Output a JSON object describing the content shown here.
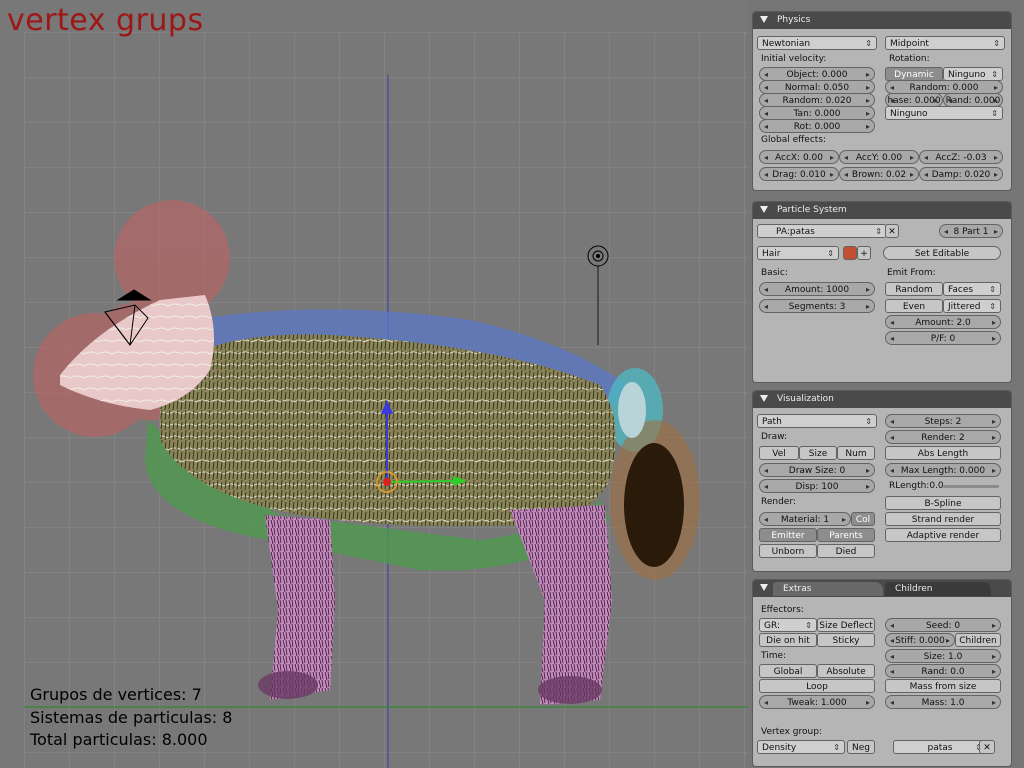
{
  "viewport": {
    "title": "vertex grups",
    "stats": [
      "Grupos de vertices: 7",
      "Sistemas de particulas: 8",
      "Total particulas: 8.000"
    ]
  },
  "physics": {
    "header": "Physics",
    "mode": "Newtonian",
    "integrator": "Midpoint",
    "initial_velocity_label": "Initial velocity:",
    "rotation_label": "Rotation:",
    "object": "Object: 0.000",
    "normal": "Normal: 0.050",
    "random": "Random: 0.020",
    "tan": "Tan: 0.000",
    "rot": "Rot: 0.000",
    "dynamic": "Dynamic",
    "ninguno1": "Ninguno",
    "rot_random": "Random: 0.000",
    "phase": "hase: 0.000",
    "rand": "Rand: 0.000",
    "ninguno2": "Ninguno",
    "global_label": "Global effects:",
    "accx": "AccX: 0.00",
    "accy": "AccY: 0.00",
    "accz": "AccZ: -0.03",
    "drag": "Drag: 0.010",
    "brown": "Brown: 0.02",
    "damp": "Damp: 0.020"
  },
  "particle_system": {
    "header": "Particle System",
    "name": "PA:patas",
    "part": "8 Part 1",
    "type": "Hair",
    "set_editable": "Set Editable",
    "basic_label": "Basic:",
    "emit_label": "Emit From:",
    "amount": "Amount: 1000",
    "segments": "Segments: 3",
    "random": "Random",
    "faces": "Faces",
    "even": "Even",
    "jittered": "Jittered",
    "emit_amount": "Amount: 2.0",
    "pf": "P/F: 0"
  },
  "visualization": {
    "header": "Visualization",
    "path": "Path",
    "draw_label": "Draw:",
    "vel": "Vel",
    "size": "Size",
    "num": "Num",
    "draw_size": "Draw Size: 0",
    "disp": "Disp: 100",
    "render_label": "Render:",
    "material": "Material: 1",
    "col": "Col",
    "emitter": "Emitter",
    "parents": "Parents",
    "unborn": "Unborn",
    "died": "Died",
    "steps": "Steps: 2",
    "render": "Render: 2",
    "abs_length": "Abs Length",
    "max_length": "Max Length: 0.000",
    "rlength": "RLength:0.0",
    "bspline": "B-Spline",
    "strand_render": "Strand render",
    "adaptive_render": "Adaptive render"
  },
  "extras": {
    "tab_extras": "Extras",
    "tab_children": "Children",
    "effectors_label": "Effectors:",
    "gr": "GR:",
    "size_deflect": "Size Deflect",
    "die_on_hit": "Die on hit",
    "sticky": "Sticky",
    "time_label": "Time:",
    "global": "Global",
    "absolute": "Absolute",
    "loop": "Loop",
    "tweak": "Tweak: 1.000",
    "seed": "Seed: 0",
    "stiff": "Stiff: 0.000",
    "children": "Children",
    "size": "Size: 1.0",
    "rand": "Rand: 0.0",
    "mass_from_size": "Mass from size",
    "mass": "Mass: 1.0",
    "vertex_group_label": "Vertex group:",
    "density": "Density",
    "neg": "Neg",
    "group_name": "patas"
  },
  "colors": {
    "title": "#9e1616",
    "panel": "#b5b5b5",
    "header": "#4a4a4a",
    "viewport": "#787878"
  }
}
